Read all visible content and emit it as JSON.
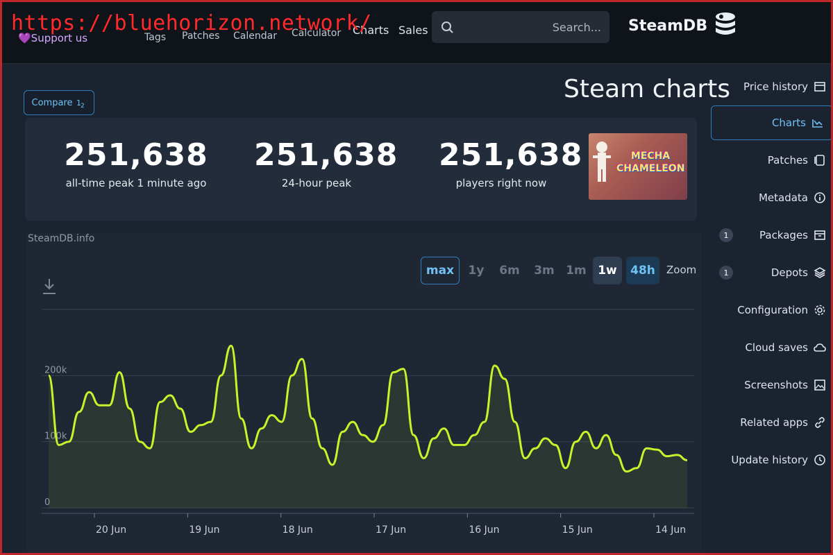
{
  "url_overlay": "https://bluehorizon.network/",
  "header": {
    "logo_text": "SteamDB",
    "search_placeholder": "Search...",
    "nav": {
      "sales": "Sales",
      "charts": "Charts",
      "calculator": "Calculator",
      "calendar": "Calendar",
      "patches": "Patches",
      "tags": "Tags"
    },
    "support": "💜Support us"
  },
  "page_title": "Steam charts",
  "compare": {
    "label": "Compare",
    "icon": "compare-icon"
  },
  "stats": {
    "game_title_line1": "MECHA",
    "game_title_line2": "CHAMELEON",
    "players_now": {
      "value": "251,638",
      "label": "players right now"
    },
    "peak_24h": {
      "value": "251,638",
      "label": "24-hour peak"
    },
    "peak_all_time": {
      "value": "251,638",
      "label": "all-time peak 1 minute ago"
    }
  },
  "chart_credit": "SteamDB.info",
  "zoom": {
    "label": "Zoom",
    "options": [
      "48h",
      "1w",
      "1m",
      "3m",
      "6m",
      "1y",
      "max"
    ],
    "selected": "1w"
  },
  "sidebar": {
    "items": [
      {
        "label": "Price history",
        "icon": "price-history-icon"
      },
      {
        "label": "Charts",
        "icon": "charts-icon",
        "active": true
      },
      {
        "label": "Patches",
        "icon": "patches-icon"
      },
      {
        "label": "Metadata",
        "icon": "info-icon"
      },
      {
        "label": "Packages",
        "icon": "packages-icon",
        "badge": "1"
      },
      {
        "label": "Depots",
        "icon": "depots-icon",
        "badge": "1"
      },
      {
        "label": "Configuration",
        "icon": "gear-icon"
      },
      {
        "label": "Cloud saves",
        "icon": "cloud-icon"
      },
      {
        "label": "Screenshots",
        "icon": "image-icon"
      },
      {
        "label": "Related apps",
        "icon": "link-icon"
      },
      {
        "label": "Update history",
        "icon": "history-icon"
      }
    ]
  },
  "colors": {
    "accent": "#6fc2f3",
    "line": "#c9f22a",
    "background": "#1b2230",
    "panel": "#232c3a"
  },
  "chart_data": {
    "type": "area",
    "title": "",
    "xlabel": "",
    "ylabel": "",
    "x_ticks": [
      "14 Jun",
      "15 Jun",
      "16 Jun",
      "17 Jun",
      "18 Jun",
      "19 Jun",
      "20 Jun"
    ],
    "y_ticks": [
      "0",
      "100k",
      "200k"
    ],
    "ylim": [
      0,
      300000
    ],
    "grid": true,
    "series": [
      {
        "values": [
          72000,
          80000,
          78000,
          88000,
          90000,
          60000,
          55000,
          80000,
          110000,
          90000,
          115000,
          100000,
          60000,
          95000,
          105000,
          90000,
          75000,
          130000,
          195000,
          215000,
          130000,
          110000,
          95000,
          95000,
          120000,
          105000,
          75000,
          110000,
          210000,
          205000,
          125000,
          100000,
          110000,
          130000,
          115000,
          65000,
          90000,
          135000,
          225000,
          200000,
          130000,
          140000,
          120000,
          90000,
          135000,
          245000,
          200000,
          130000,
          125000,
          115000,
          150000,
          170000,
          160000,
          90000,
          100000,
          150000,
          205000,
          155000,
          155000,
          175000,
          145000,
          100000,
          95000,
          200000
        ]
      }
    ]
  }
}
